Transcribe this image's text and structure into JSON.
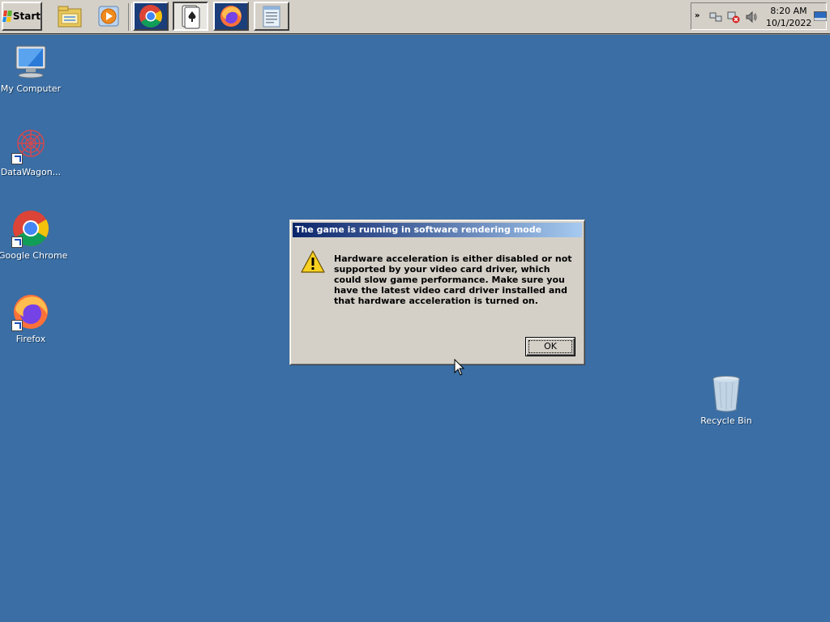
{
  "taskbar": {
    "start_label": "Start",
    "quick_launch": [
      {
        "name": "file-explorer-icon"
      },
      {
        "name": "media-player-icon"
      }
    ],
    "tasks": [
      {
        "name": "chrome-icon"
      },
      {
        "name": "solitaire-icon"
      },
      {
        "name": "firefox-icon"
      },
      {
        "name": "notepad-window-icon"
      }
    ],
    "tray": {
      "icons": [
        "network-icon",
        "network-error-icon",
        "volume-icon"
      ],
      "time": "8:20 AM",
      "date": "10/1/2022"
    }
  },
  "desktop": {
    "icons": [
      {
        "id": "my-computer",
        "label": "My Computer",
        "icon": "computer-icon"
      },
      {
        "id": "datawagon",
        "label": "DataWagon...",
        "icon": "datawagon-icon"
      },
      {
        "id": "google-chrome",
        "label": "Google Chrome",
        "icon": "chrome-icon"
      },
      {
        "id": "firefox",
        "label": "Firefox",
        "icon": "firefox-icon"
      },
      {
        "id": "recycle-bin",
        "label": "Recycle Bin",
        "icon": "recycle-bin-icon"
      }
    ]
  },
  "dialog": {
    "title": "The game is running in software rendering mode",
    "message": "Hardware acceleration is either disabled or not supported by your video card driver, which could slow game performance. Make sure you have the latest video card driver installed and that hardware acceleration is turned on.",
    "ok_label": "OK",
    "icon": "warning-icon"
  },
  "colors": {
    "desktop": "#3a6ea5",
    "chrome": "#d4d0c8",
    "title_start": "#0a246a",
    "title_end": "#a6caf0"
  }
}
